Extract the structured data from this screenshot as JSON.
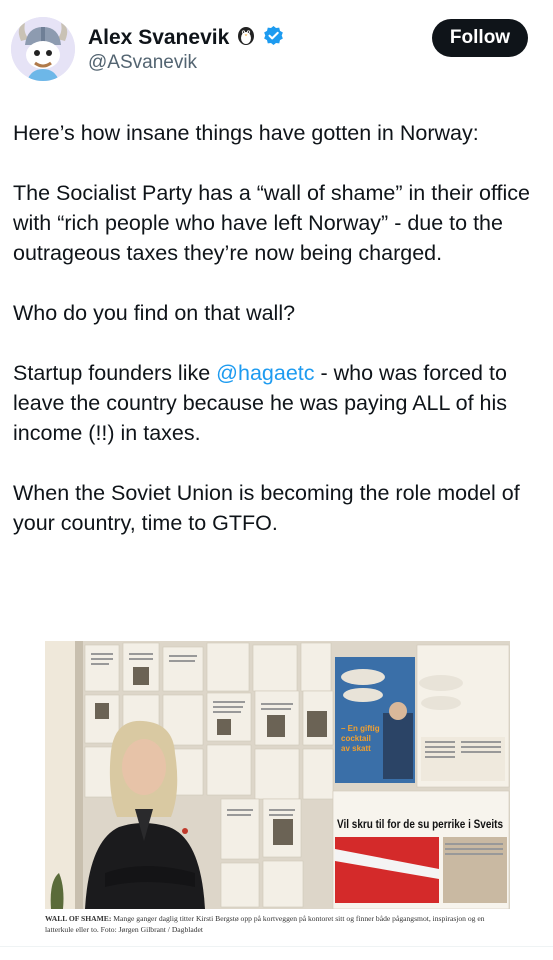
{
  "author": {
    "name": "Alex Svanevik",
    "handle": "@ASvanevik",
    "emoji_icon": "penguin-icon",
    "verified_icon": "verified-badge-icon"
  },
  "follow_label": "Follow",
  "tweet": {
    "p1": "Here’s how insane things have gotten in Norway:",
    "p2": "The Socialist Party has a “wall of shame” in their office with “rich people who have left Norway” - due to the outrageous taxes they’re now being charged.",
    "p3": "Who do you find on that wall?",
    "p4_before": "Startup founders like ",
    "p4_mention": "@hagaetc",
    "p4_after": " - who was forced to leave the country because he was paying ALL of his income (!!) in taxes.",
    "p5": "When the Soviet Union is becoming the role model of your country, time to GTFO."
  },
  "image": {
    "headline_1": "Vil skru til for de su perrike i Sveits",
    "headline_2_l1": "– En giftig",
    "headline_2_l2": "cocktail",
    "headline_2_l3": "av skatt",
    "caption_bold": "WALL OF SHAME:",
    "caption_text": " Mange ganger daglig titter Kirsti Bergstø opp på kortveggen på kontoret sitt og finner både pågangsmot, inspirasjon og en latterkule eller to. Foto: Jørgen Gilbrant / Dagbladet"
  },
  "colors": {
    "accent": "#1d9bf0",
    "text": "#0f1419",
    "secondary": "#536471"
  }
}
